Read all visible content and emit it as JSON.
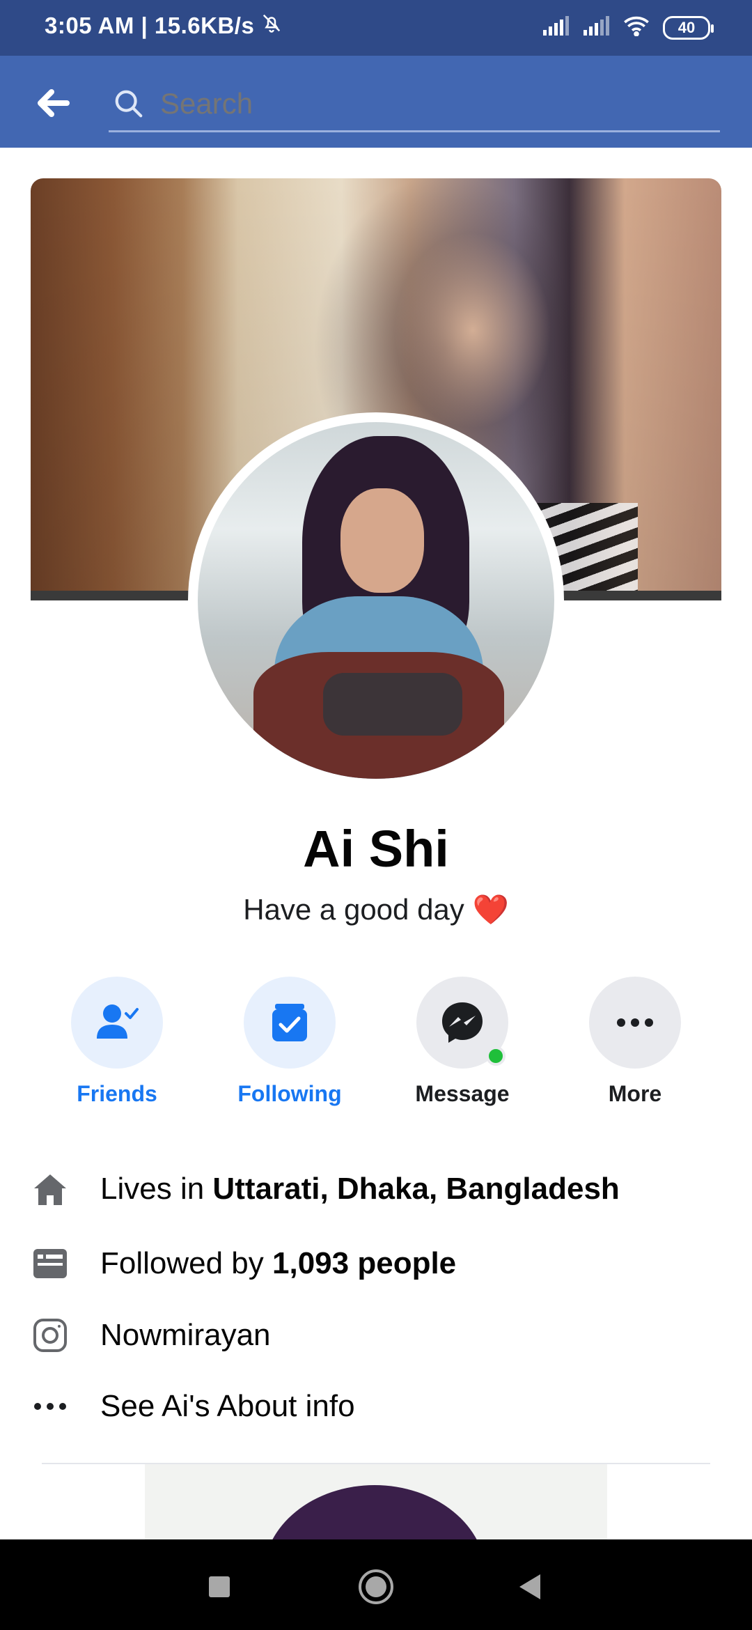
{
  "status_bar": {
    "time_speed": "3:05 AM | 15.6KB/s",
    "battery": "40"
  },
  "app_bar": {
    "search_placeholder": "Search"
  },
  "profile": {
    "name": "Ai Shi",
    "bio": "Have a good day",
    "bio_emoji": "❤️"
  },
  "actions": [
    {
      "label": "Friends",
      "icon": "friends-check-icon",
      "color": "#1877f2"
    },
    {
      "label": "Following",
      "icon": "following-check-icon",
      "color": "#1877f2"
    },
    {
      "label": "Message",
      "icon": "messenger-icon",
      "color": "#1c1e21"
    },
    {
      "label": "More",
      "icon": "more-dots-icon",
      "color": "#1c1e21"
    }
  ],
  "info": {
    "lives_prefix": "Lives in ",
    "lives_location": "Uttarati, Dhaka, Bangladesh",
    "followed_prefix": "Followed by ",
    "followed_count": "1,093 people",
    "instagram": "Nowmirayan",
    "about": "See Ai's About info"
  }
}
